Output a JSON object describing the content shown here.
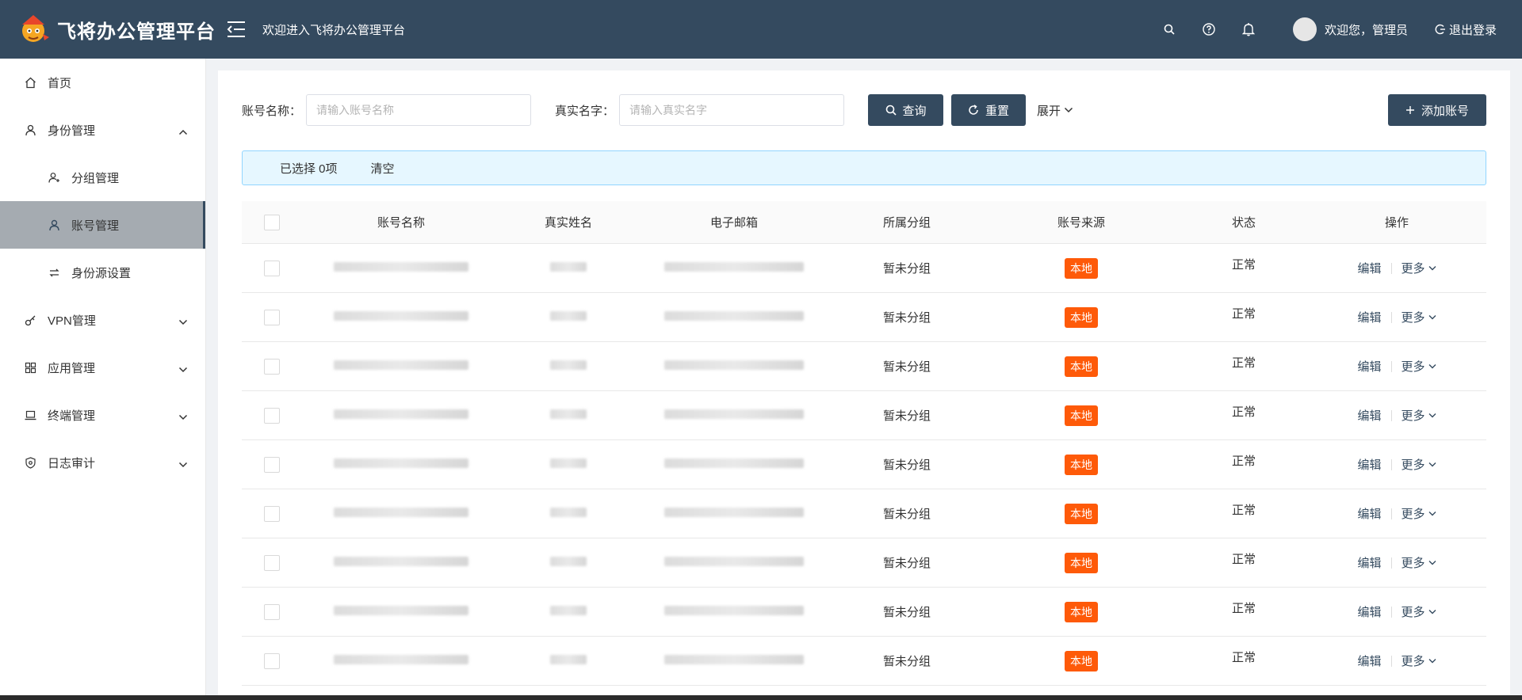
{
  "header": {
    "logo_text": "飞将办公管理平台",
    "welcome": "欢迎进入飞将办公管理平台",
    "user_greet": "欢迎您，管理员",
    "logout": "退出登录"
  },
  "sidebar": {
    "items": [
      {
        "label": "首页"
      },
      {
        "label": "身份管理"
      },
      {
        "label": "分组管理"
      },
      {
        "label": "账号管理"
      },
      {
        "label": "身份源设置"
      },
      {
        "label": "VPN管理"
      },
      {
        "label": "应用管理"
      },
      {
        "label": "终端管理"
      },
      {
        "label": "日志审计"
      }
    ]
  },
  "search": {
    "account_label": "账号名称：",
    "account_placeholder": "请输入账号名称",
    "realname_label": "真实名字：",
    "realname_placeholder": "请输入真实名字",
    "query": "查询",
    "reset": "重置",
    "expand": "展开",
    "add": "添加账号"
  },
  "selection": {
    "selected": "已选择 0项",
    "clear": "清空"
  },
  "table": {
    "columns": [
      "账号名称",
      "真实姓名",
      "电子邮箱",
      "所属分组",
      "账号来源",
      "状态",
      "操作"
    ],
    "rows": [
      {
        "group": "暂未分组",
        "source": "本地",
        "status": "正常",
        "edit": "编辑",
        "more": "更多"
      },
      {
        "group": "暂未分组",
        "source": "本地",
        "status": "正常",
        "edit": "编辑",
        "more": "更多"
      },
      {
        "group": "暂未分组",
        "source": "本地",
        "status": "正常",
        "edit": "编辑",
        "more": "更多"
      },
      {
        "group": "暂未分组",
        "source": "本地",
        "status": "正常",
        "edit": "编辑",
        "more": "更多"
      },
      {
        "group": "暂未分组",
        "source": "本地",
        "status": "正常",
        "edit": "编辑",
        "more": "更多"
      },
      {
        "group": "暂未分组",
        "source": "本地",
        "status": "正常",
        "edit": "编辑",
        "more": "更多"
      },
      {
        "group": "暂未分组",
        "source": "本地",
        "status": "正常",
        "edit": "编辑",
        "more": "更多"
      },
      {
        "group": "暂未分组",
        "source": "本地",
        "status": "正常",
        "edit": "编辑",
        "more": "更多"
      },
      {
        "group": "暂未分组",
        "source": "本地",
        "status": "正常",
        "edit": "编辑",
        "more": "更多"
      }
    ]
  },
  "colors": {
    "primary": "#344a5f",
    "tag": "#fe5a09",
    "selection_bg": "#e6f7ff"
  }
}
